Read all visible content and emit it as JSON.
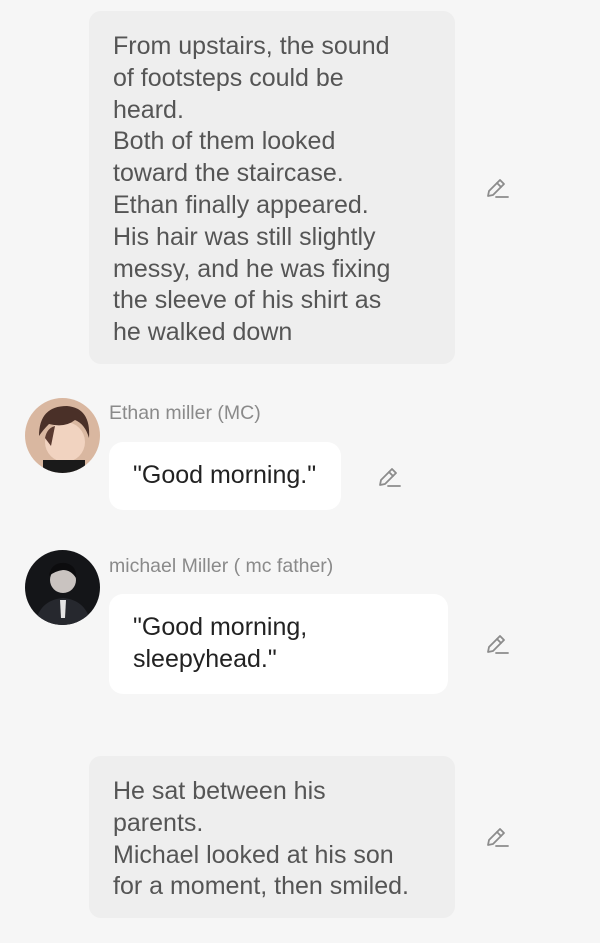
{
  "narration_1": {
    "lines": [
      "From upstairs, the sound",
      "of footsteps could be",
      "heard.",
      "Both of them looked",
      "toward the staircase.",
      "Ethan finally appeared.",
      "His hair was still slightly",
      "messy, and he was fixing",
      "the sleeve of his shirt as",
      "he walked down"
    ],
    "edit_icon": "pencil-icon"
  },
  "message_1": {
    "speaker": "Ethan miller (MC)",
    "avatar_icon": "avatar-ethan",
    "lines": [
      "\"Good morning.\""
    ],
    "edit_icon": "pencil-icon"
  },
  "message_2": {
    "speaker": "michael Miller ( mc father)",
    "avatar_icon": "avatar-michael",
    "lines": [
      "\"Good morning,",
      "sleepyhead.\""
    ],
    "edit_icon": "pencil-icon"
  },
  "narration_2": {
    "lines": [
      "He sat between his",
      "parents.",
      "Michael looked at his son",
      "for a moment, then smiled."
    ],
    "edit_icon": "pencil-icon"
  },
  "colors": {
    "background": "#f6f6f6",
    "narration_bg": "#eeeeee",
    "bubble_bg": "#ffffff",
    "name_text": "#8a8a8a",
    "icon": "#8c8c8c"
  }
}
